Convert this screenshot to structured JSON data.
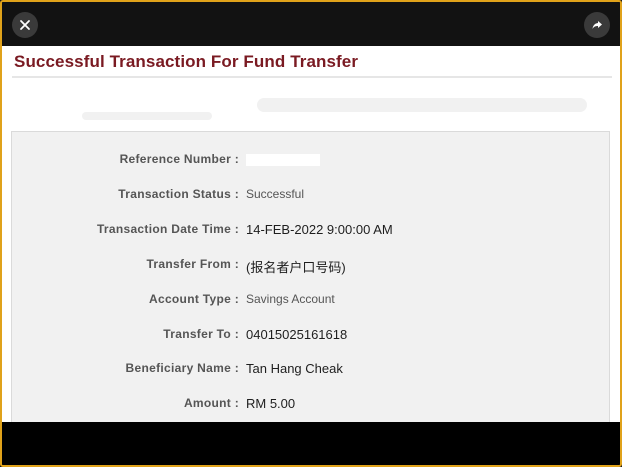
{
  "toolbar": {
    "close_icon": "close-icon",
    "share_icon": "share-icon"
  },
  "page": {
    "title": "Successful Transaction For Fund Transfer"
  },
  "details": {
    "reference_number": {
      "label": "Reference Number :",
      "value": ""
    },
    "transaction_status": {
      "label": "Transaction Status :",
      "value": "Successful"
    },
    "transaction_date_time": {
      "label": "Transaction Date Time :",
      "value": "14-FEB-2022 9:00:00 AM"
    },
    "transfer_from": {
      "label": "Transfer From :",
      "value": "(报名者户口号码)"
    },
    "account_type": {
      "label": "Account Type :",
      "value": "Savings Account"
    },
    "transfer_to": {
      "label": "Transfer To :",
      "value": "04015025161618"
    },
    "beneficiary_name": {
      "label": "Beneficiary Name :",
      "value": "Tan Hang Cheak"
    },
    "amount": {
      "label": "Amount :",
      "value": "RM 5.00"
    }
  },
  "colors": {
    "frame_border": "#e0a21a",
    "title": "#7a1a22",
    "panel": "#f1f1f1"
  }
}
